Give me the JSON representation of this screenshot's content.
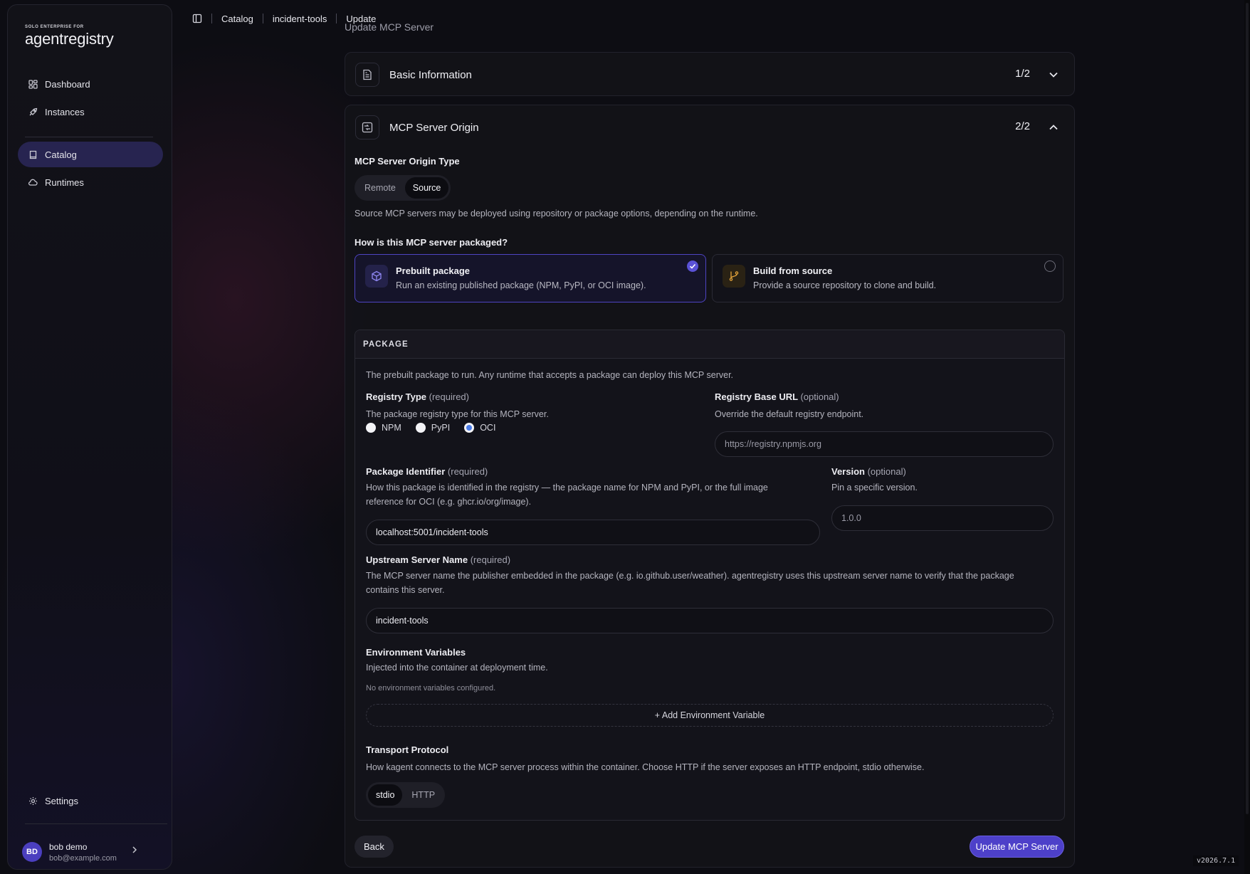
{
  "brand": {
    "small": "SOLO ENTERPRISE FOR",
    "name": "agentregistry"
  },
  "sidebar": {
    "items": [
      {
        "label": "Dashboard"
      },
      {
        "label": "Instances"
      },
      {
        "label": "Catalog"
      },
      {
        "label": "Runtimes"
      }
    ],
    "settings_label": "Settings"
  },
  "user": {
    "initials": "BD",
    "name": "bob demo",
    "email": "bob@example.com"
  },
  "breadcrumbs": [
    "Catalog",
    "incident-tools",
    "Update"
  ],
  "page_title": "Update MCP Server",
  "sections": {
    "basic": {
      "title": "Basic Information",
      "step": "1/2"
    },
    "origin": {
      "title": "MCP Server Origin",
      "step": "2/2"
    }
  },
  "origin": {
    "type_label": "MCP Server Origin Type",
    "type_options": [
      "Remote",
      "Source"
    ],
    "type_selected": "Source",
    "type_description": "Source MCP servers may be deployed using repository or package options, depending on the runtime.",
    "packaged_question": "How is this MCP server packaged?",
    "options": [
      {
        "title": "Prebuilt package",
        "description": "Run an existing published package (NPM, PyPI, or OCI image).",
        "selected": true
      },
      {
        "title": "Build from source",
        "description": "Provide a source repository to clone and build.",
        "selected": false
      }
    ]
  },
  "package": {
    "heading": "PACKAGE",
    "description": "The prebuilt package to run. Any runtime that accepts a package can deploy this MCP server.",
    "registry_type": {
      "label": "Registry Type",
      "hint": "(required)",
      "description": "The package registry type for this MCP server.",
      "options": [
        "NPM",
        "PyPI",
        "OCI"
      ],
      "selected": "OCI"
    },
    "registry_base_url": {
      "label": "Registry Base URL",
      "hint": "(optional)",
      "description": "Override the default registry endpoint.",
      "placeholder": "https://registry.npmjs.org"
    },
    "identifier": {
      "label": "Package Identifier",
      "hint": "(required)",
      "description_line1": "How this package is identified in the registry — the package name for NPM and PyPI, or the full image",
      "description_line2": "reference for OCI (e.g. ghcr.io/org/image).",
      "value": "localhost:5001/incident-tools"
    },
    "version": {
      "label": "Version",
      "hint": "(optional)",
      "description": "Pin a specific version.",
      "placeholder": "1.0.0"
    },
    "upstream": {
      "label": "Upstream Server Name",
      "hint": "(required)",
      "description_line1": "The MCP server name the publisher embedded in the package (e.g. io.github.user/weather). agentregistry uses this upstream server name to verify that the package",
      "description_line2": "contains this server.",
      "value": "incident-tools"
    },
    "env": {
      "label": "Environment Variables",
      "description": "Injected into the container at deployment time.",
      "empty_text": "No environment variables configured.",
      "add_label": "+ Add Environment Variable"
    },
    "transport": {
      "label": "Transport Protocol",
      "description": "How kagent connects to the MCP server process within the container. Choose HTTP if the server exposes an HTTP endpoint, stdio otherwise.",
      "options": [
        "stdio",
        "HTTP"
      ],
      "selected": "stdio"
    }
  },
  "actions": {
    "back_label": "Back",
    "submit_label": "Update MCP Server"
  },
  "version_tag": "v2026.7.1",
  "colors": {
    "accent": "#4d40c9",
    "selected_border": "#4e44c2",
    "radio_checked": "#4c7de8",
    "source_icon": "#e3a23a"
  }
}
